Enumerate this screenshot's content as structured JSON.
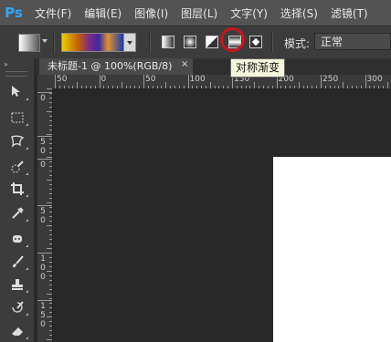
{
  "app": {
    "logo": "Ps"
  },
  "menu": [
    "文件(F)",
    "编辑(E)",
    "图像(I)",
    "图层(L)",
    "文字(Y)",
    "选择(S)",
    "滤镜(T)"
  ],
  "options": {
    "gradient_types": [
      "linear-gradient-icon",
      "radial-gradient-icon",
      "angle-gradient-icon",
      "reflected-gradient-icon",
      "diamond-gradient-icon"
    ],
    "mode_label": "模式:",
    "mode_value": "正常",
    "highlight_color": "#c8161d"
  },
  "tooltip": "对称渐变",
  "document": {
    "tab_title": "未标题-1 @ 100%(RGB/8)",
    "close": "×"
  },
  "ruler": {
    "h_labels": [
      "50",
      "0",
      "50",
      "100",
      "150",
      "200",
      "250",
      "300",
      "350"
    ],
    "v_labels": [
      "0",
      "5\n0",
      "0",
      "5\n0",
      "1\n0\n0",
      "1\n5\n0"
    ]
  },
  "toolbar": {
    "collapse": "»",
    "tools": [
      "move-icon",
      "marquee-icon",
      "lasso-icon",
      "quick-select-icon",
      "crop-icon",
      "eyedropper-icon",
      "spot-healing-icon",
      "brush-icon",
      "clone-stamp-icon",
      "history-brush-icon",
      "eraser-icon"
    ]
  }
}
